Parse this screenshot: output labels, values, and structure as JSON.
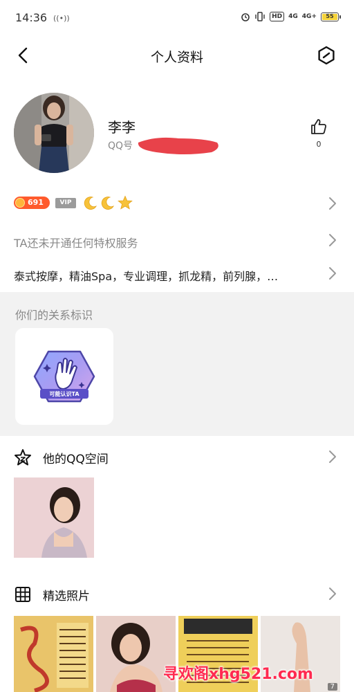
{
  "status": {
    "time": "14:36",
    "hotspot": "((•))",
    "hd_label": "HD",
    "network_1": "4G",
    "network_2": "4G+",
    "battery": "55"
  },
  "nav": {
    "title": "个人资料",
    "back_icon": "chevron-left-icon",
    "menu_icon": "hexagon-menu-icon"
  },
  "profile": {
    "name": "李李",
    "qq_label": "QQ号",
    "like_count": "0"
  },
  "badges": {
    "level": "691",
    "vip": "VIP",
    "icons": [
      "moon-icon",
      "moon-icon",
      "star-icon"
    ]
  },
  "privilege": {
    "text": "TA还未开通任何特权服务"
  },
  "tags": {
    "text": "泰式按摩，精油Spa，专业调理，抓龙精，前列腺，…"
  },
  "relation": {
    "title": "你们的关系标识",
    "badge_label": "可能认识TA"
  },
  "qzone": {
    "label": "他的QQ空间"
  },
  "photos": {
    "label": "精选照片",
    "count": "7"
  },
  "watermark": {
    "text": "寻欢阁xhg521.com"
  },
  "colors": {
    "accent_red": "#ff2a50",
    "level_badge": "#ff5a2c",
    "section_bg": "#f2f2f2"
  }
}
